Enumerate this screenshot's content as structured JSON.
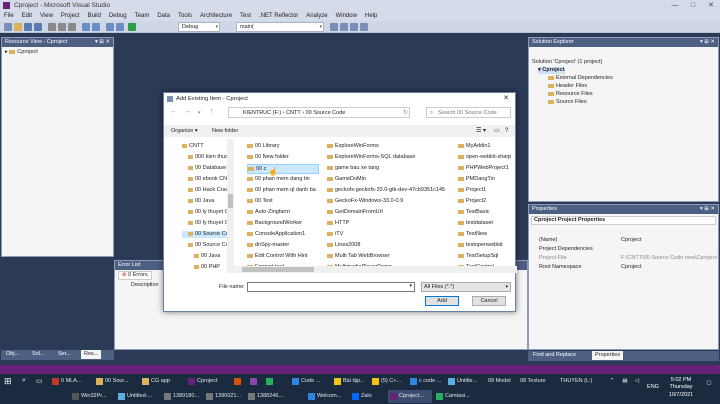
{
  "window": {
    "title": "Cproject - Microsoft Visual Studio"
  },
  "menu": [
    "File",
    "Edit",
    "View",
    "Project",
    "Build",
    "Debug",
    "Team",
    "Data",
    "Tools",
    "Architecture",
    "Test",
    ".NET Reflector",
    "Analyze",
    "Window",
    "Help"
  ],
  "toolbar": {
    "config": "Debug",
    "target": "main("
  },
  "resource_view": {
    "title": "Resource View - Cproject",
    "root": "Cproject"
  },
  "solution_explorer": {
    "title": "Solution Explorer",
    "solution": "Solution 'Cproject' (1 project)",
    "project": "Cproject",
    "items": [
      "External Dependencies",
      "Header Files",
      "Resource Files",
      "Source Files"
    ]
  },
  "properties": {
    "title": "Properties",
    "object": "Cproject Project Properties",
    "rows": [
      {
        "name": "(Name)",
        "value": "Cproject"
      },
      {
        "name": "Project Dependencies",
        "value": ""
      },
      {
        "name": "Project File",
        "value": "F:\\CNTT\\00 Source Code new\\Cproject"
      },
      {
        "name": "Root Namespace",
        "value": "Cproject"
      }
    ],
    "tabs": [
      "Find and Replace",
      "Properties"
    ]
  },
  "error_list": {
    "title": "Error List",
    "errors": "0 Errors",
    "col": "Description"
  },
  "bottom_tabs": [
    "Obj...",
    "Sol...",
    "Ser...",
    "Res..."
  ],
  "dialog": {
    "title": "Add Existing Item - Cproject",
    "breadcrumb": [
      "KIENTRUC (F:)",
      "CNTT",
      "00 Source Code"
    ],
    "search_placeholder": "Search 00 Source Code",
    "organize": "Organize ▾",
    "new_folder": "New folder",
    "nav_items": [
      "CNTT",
      "000 kien thuc",
      "00 Database",
      "00 ebook CN",
      "00 Hack Crack",
      "00 Java",
      "00 ly thuyet C",
      "00 ly thuyet C",
      "00 Source Co",
      "00 Source Co",
      "00 Java",
      "00 PHP"
    ],
    "files_col1": [
      "00 Library",
      "00 New folder",
      "00 c",
      "00 phan mem dang tin",
      "00 phan mem ql danh ba",
      "00 Test",
      "Auto-Zingfarm",
      "BackgroundWorker",
      "ConsoleApplication1",
      "dnSpy-master",
      "Edit Control With Hint",
      "Encrypt tool"
    ],
    "files_col2": [
      "ExploreWinForms",
      "ExploreWinForms-SQL database",
      "game bau xe tang",
      "GameDoMin",
      "geckofx-geckofx-33.0-gtk-dev-47cb9351c145",
      "GeckoFx-Windows-33.0-0.9",
      "GetDomainFromUrl",
      "HTTP",
      "iTV",
      "Lines2008",
      "Multi Tab WebBrowser",
      "MultimediaPlayerDemo"
    ],
    "files_col3": [
      "MyAddin1",
      "open-webkit-sharp",
      "PHPWebProject1",
      "PMDangTin",
      "Project1",
      "Project2",
      "TestBasic",
      "testdataset",
      "TestNew",
      "testopenwebkit",
      "TestSetupSql",
      "TextControl"
    ],
    "file_name_label": "File name:",
    "file_type": "All Files (*.*)",
    "add": "Add",
    "cancel": "Cancel"
  },
  "taskbar": {
    "row1": [
      "0 MLA...",
      "00 Sour...",
      "CG app",
      "Cproject",
      "",
      "",
      "",
      "Code ...",
      "Bài tập...",
      "(5) C+...",
      "c code ...",
      "Untitle...",
      "09 Model",
      "08 Texture",
      "THUYEN (L:)"
    ],
    "row2": [
      "Win32Pr...",
      "Untitled-...",
      "1389180...",
      "1390021...",
      "1388246...",
      "Welcom...",
      "Zalo",
      "Cproject...",
      "Camtasi..."
    ],
    "lang": "ENG",
    "time": "5:02 PM",
    "day": "Thursday",
    "date": "10/7/2021"
  }
}
